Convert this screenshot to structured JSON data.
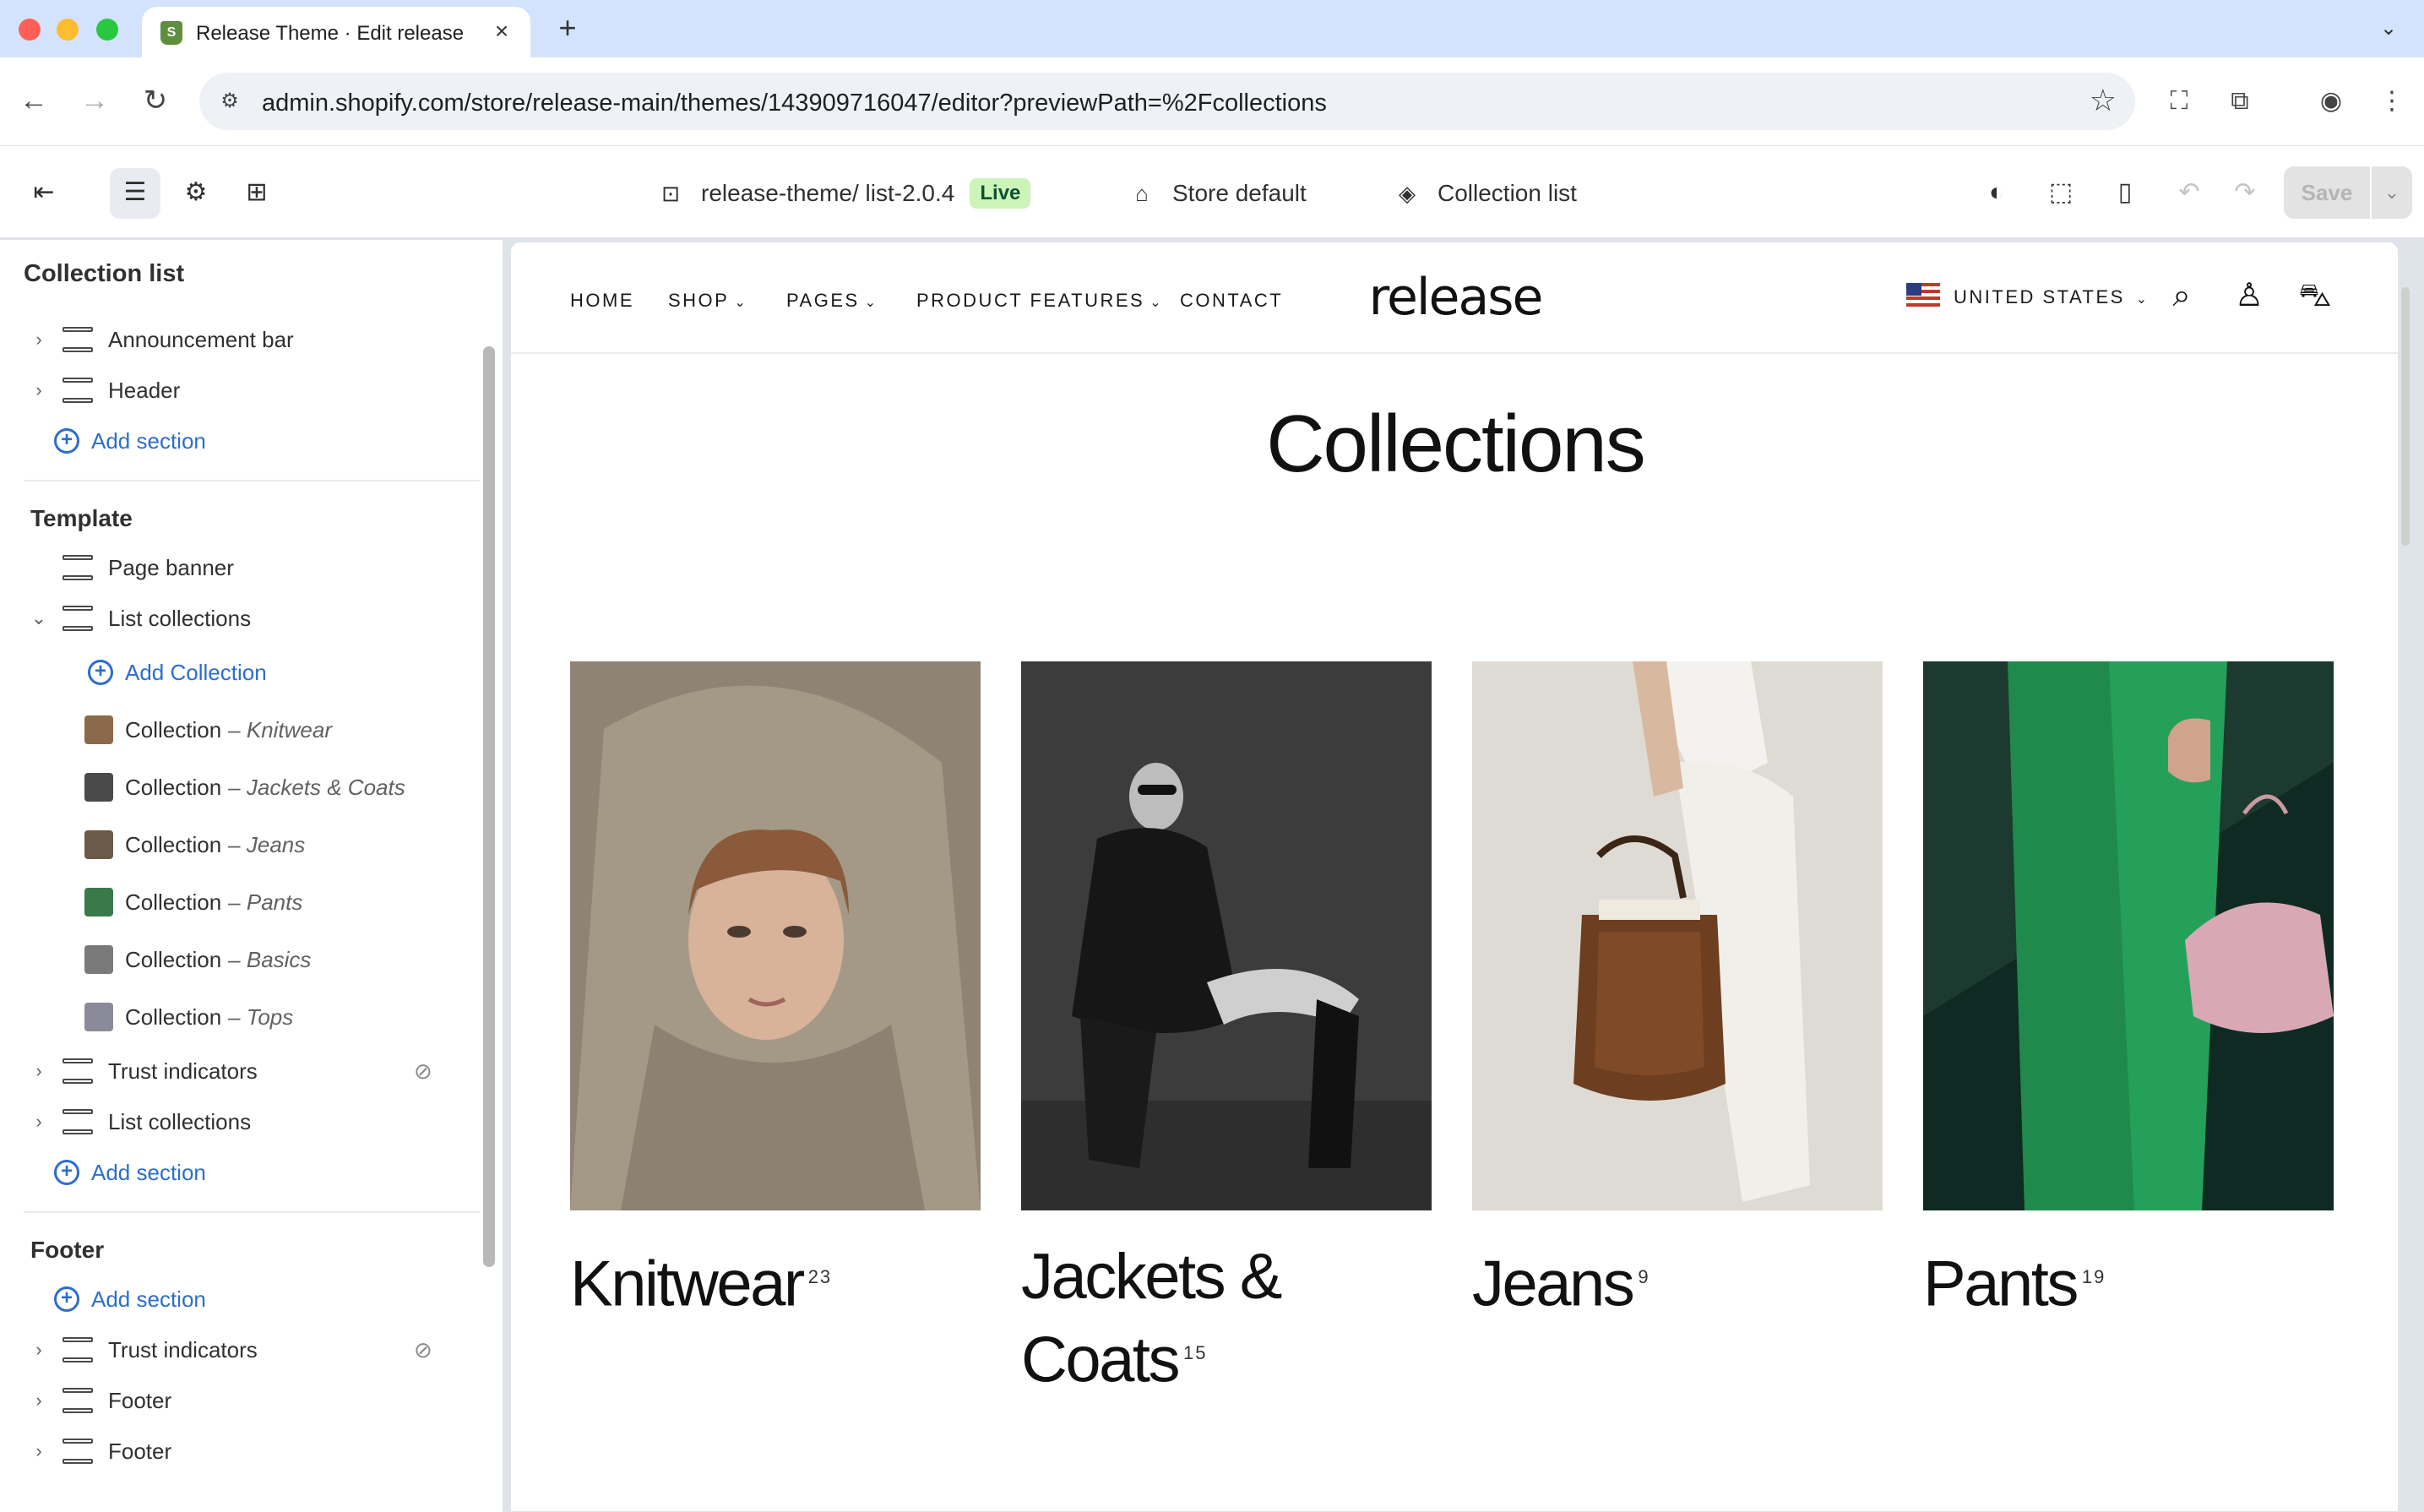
{
  "browser": {
    "tab_title": "Release Theme · Edit release",
    "tab_close": "×",
    "new_tab": "+",
    "url_host": "admin.shopify.com",
    "url_path": "/store/release-main/themes/143909716047/editor?previewPath=%2Fcollections"
  },
  "editor": {
    "theme_name": "release-theme/ list-2.0.4",
    "live_badge": "Live",
    "market": "Store default",
    "template": "Collection list",
    "save_label": "Save"
  },
  "sidebar": {
    "title": "Collection list",
    "header_group": [
      {
        "label": "Announcement bar"
      },
      {
        "label": "Header"
      }
    ],
    "add_section_label": "Add section",
    "template_title": "Template",
    "page_banner": "Page banner",
    "list_collections": "List collections",
    "add_collection_label": "Add Collection",
    "collection_prefix": "Collection",
    "collections": [
      {
        "name": "– Knitwear",
        "color": "#8a6a4a"
      },
      {
        "name": "– Jackets & Coats",
        "color": "#4a4a4a"
      },
      {
        "name": "– Jeans",
        "color": "#6b5a48"
      },
      {
        "name": "– Pants",
        "color": "#3a7a4a"
      },
      {
        "name": "– Basics",
        "color": "#7a7a7a"
      },
      {
        "name": "– Tops",
        "color": "#8a8a9a"
      }
    ],
    "trust_indicators": "Trust indicators",
    "list_collections_2": "List collections",
    "footer_title": "Footer",
    "footer_items": [
      {
        "label": "Trust indicators"
      },
      {
        "label": "Footer"
      },
      {
        "label": "Footer"
      }
    ]
  },
  "store": {
    "nav": {
      "home": "HOME",
      "shop": "SHOP",
      "pages": "PAGES",
      "product_features": "PRODUCT FEATURES",
      "contact": "CONTACT"
    },
    "logo": "release",
    "country": "UNITED STATES",
    "heading": "Collections",
    "cards": [
      {
        "title": "Knitwear",
        "count": "23"
      },
      {
        "title": "Jackets &",
        "title2": "Coats",
        "count": "15"
      },
      {
        "title": "Jeans",
        "count": "9"
      },
      {
        "title": "Pants",
        "count": "19"
      }
    ]
  },
  "colors": {
    "accent": "#2c6ecb",
    "live_bg": "#cdf4b8",
    "live_text": "#0c5132",
    "tabbar": "#d3e3fd"
  }
}
